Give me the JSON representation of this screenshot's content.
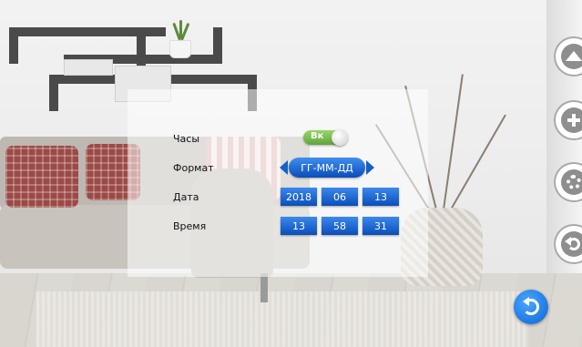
{
  "settings": {
    "clock": {
      "label": "Часы",
      "toggle_text": "Вк",
      "enabled": true
    },
    "format": {
      "label": "Формат",
      "value": "ГГ-ММ-ДД"
    },
    "date": {
      "label": "Дата",
      "year": "2018",
      "month": "06",
      "day": "13"
    },
    "time": {
      "label": "Время",
      "hour": "13",
      "minute": "58",
      "second": "31"
    }
  },
  "side_nav": {
    "icons": [
      "up-icon",
      "add-icon",
      "settings-icon",
      "back-icon"
    ]
  },
  "colors": {
    "accent_blue": "#1560c8",
    "toggle_green": "#5ea63a",
    "return_button": "#0a64d6"
  }
}
